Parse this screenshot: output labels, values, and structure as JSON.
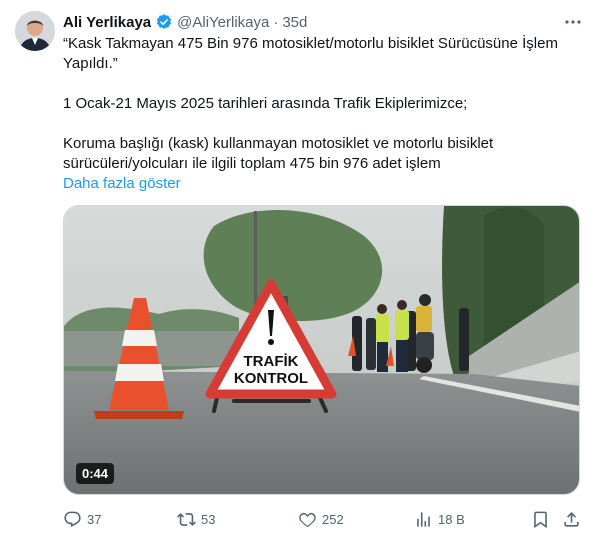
{
  "tweet": {
    "author_name": "Ali Yerlikaya",
    "handle": "@AliYerlikaya",
    "separator": "·",
    "time": "35d",
    "lines": [
      "“Kask Takmayan 475 Bin 976 motosiklet/motorlu bisiklet Sürücüsüne İşlem",
      "Yapıldı.”",
      "",
      "1 Ocak-21 Mayıs 2025 tarihleri arasında Trafik Ekiplerimizce;",
      "",
      "Koruma başlığı (kask) kullanmayan motosiklet ve motorlu bisiklet",
      "sürücüleri/yolcuları ile ilgili toplam 475 bin 976 adet işlem"
    ],
    "show_more": "Daha fazla göster"
  },
  "media": {
    "sign_line1": "TRAFİK",
    "sign_line2": "KONTROL",
    "duration": "0:44"
  },
  "actions": {
    "replies": "37",
    "reposts": "53",
    "likes": "252",
    "views": "18 B"
  },
  "colors": {
    "accent": "#1d9bf0",
    "verified": "#1d9bf0",
    "muted": "#536471"
  },
  "icons": [
    "verified-badge-icon",
    "more-icon",
    "reply-icon",
    "repost-icon",
    "like-icon",
    "views-icon",
    "bookmark-icon",
    "share-icon"
  ]
}
